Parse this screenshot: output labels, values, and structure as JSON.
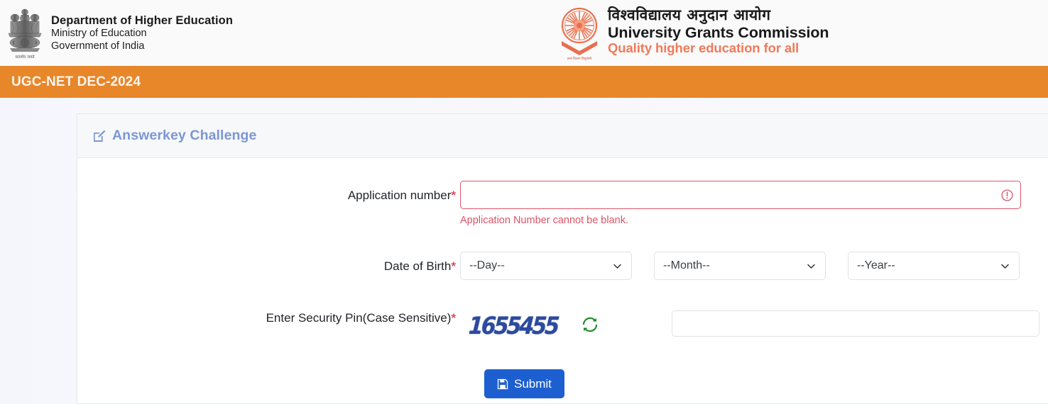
{
  "header": {
    "emblem_icon": "ashoka-lion-capital-emblem",
    "department": {
      "line1": "Department of Higher Education",
      "line2": "Ministry of Education",
      "line3": "Government of India"
    },
    "ugc": {
      "logo_icon": "ugc-chakra-logo",
      "hindi_name": "विश्वविद्यालय अनुदान आयोग",
      "english_name": "University Grants Commission",
      "tagline": "Quality higher education for all",
      "tagline_color": "#f07a5a"
    }
  },
  "banner": {
    "title": "UGC-NET DEC-2024",
    "background_color": "#e8862a",
    "text_color": "#fdf6ee"
  },
  "card": {
    "icon": "edit-square-icon",
    "title": "Answerkey Challenge",
    "title_color": "#7b97d4"
  },
  "form": {
    "application_number": {
      "label": "Application number",
      "required_marker": "*",
      "value": "",
      "placeholder": "",
      "error_icon": "exclamation-circle-icon",
      "error_message": "Application Number cannot be blank.",
      "error_color": "#d9546a"
    },
    "date_of_birth": {
      "label": "Date of Birth",
      "required_marker": "*",
      "day": {
        "selected": "--Day--"
      },
      "month": {
        "selected": "--Month--"
      },
      "year": {
        "selected": "--Year--"
      },
      "chevron_icon": "chevron-down-icon"
    },
    "security_pin": {
      "label": "Enter Security Pin(Case Sensitive)",
      "required_marker": "*",
      "captcha_text": "1655455",
      "captcha_color": "#2c4a9e",
      "refresh_icon": "refresh-icon",
      "refresh_color": "#1e8a27",
      "value": "",
      "placeholder": ""
    },
    "submit": {
      "label": "Submit",
      "icon": "save-floppy-icon",
      "background_color": "#1d5fd0"
    }
  }
}
